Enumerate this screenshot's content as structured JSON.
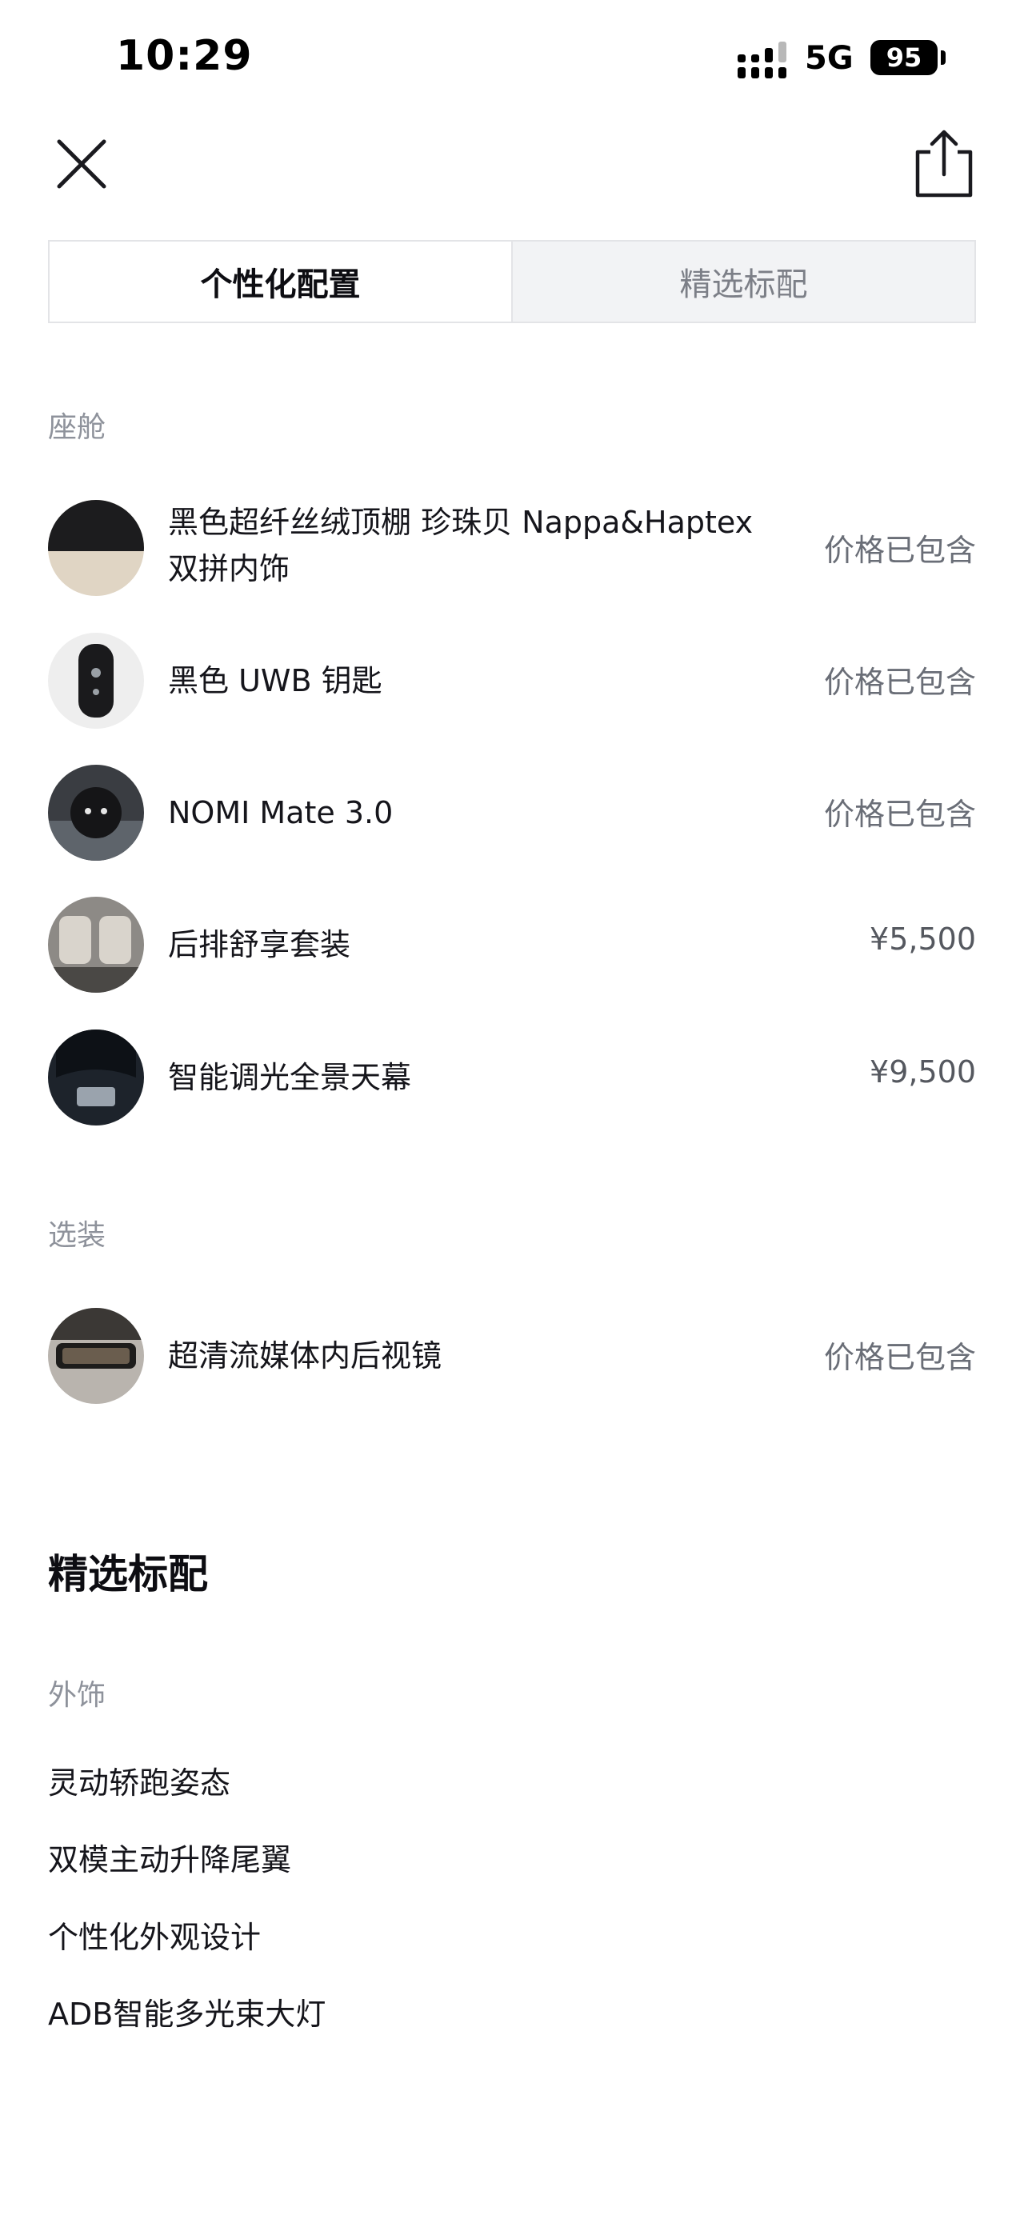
{
  "status_bar": {
    "time": "10:29",
    "network": "5G",
    "battery": "95"
  },
  "tabs": [
    {
      "label": "个性化配置",
      "active": true
    },
    {
      "label": "精选标配",
      "active": false
    }
  ],
  "cabin": {
    "label": "座舱",
    "items": [
      {
        "name_line1": "黑色超纤丝绒顶棚 珍珠贝 Nappa&Haptex",
        "name_line2": "双拼内饰",
        "price": "价格已包含"
      },
      {
        "name": "黑色 UWB 钥匙",
        "price": "价格已包含"
      },
      {
        "name": "NOMI Mate 3.0",
        "price": "价格已包含"
      },
      {
        "name": "后排舒享套装",
        "price": "¥5,500"
      },
      {
        "name": "智能调光全景天幕",
        "price": "¥9,500"
      }
    ]
  },
  "options": {
    "label": "选装",
    "items": [
      {
        "name": "超清流媒体内后视镜",
        "price": "价格已包含"
      }
    ]
  },
  "standard": {
    "heading": "精选标配",
    "exterior_label": "外饰",
    "exterior_items": [
      "灵动轿跑姿态",
      "双模主动升降尾翼",
      "个性化外观设计",
      "ADB智能多光束大灯"
    ]
  },
  "colors": {
    "accent_text": "#0d0d12",
    "muted_text": "#8e929b",
    "price_text": "#6a6e77"
  }
}
